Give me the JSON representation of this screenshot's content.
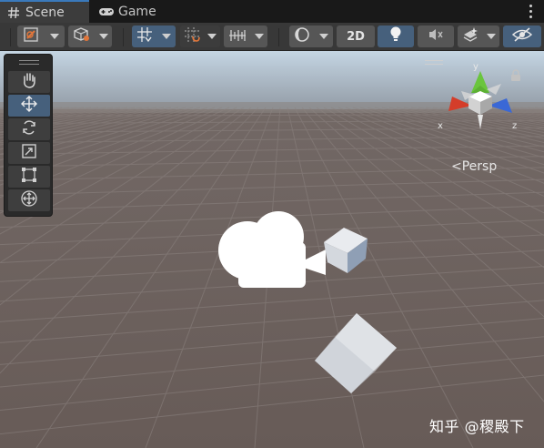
{
  "tabs": {
    "scene": {
      "label": "Scene",
      "icon": "hash-icon"
    },
    "game": {
      "label": "Game",
      "icon": "gamepad-icon"
    }
  },
  "toolbar": {
    "draw_mode_icon": "draw-mode-icon",
    "gizmo_icon": "cube-orientation-icon",
    "grid_icon": "grid-icon",
    "snap_icon": "snap-icon",
    "increment_icon": "increment-snap-icon",
    "shading_icon": "shading-icon",
    "mode_2d_label": "2D",
    "lighting_icon": "lightbulb-icon",
    "audio_icon": "audio-muted-icon",
    "effects_icon": "effects-icon",
    "visibility_icon": "hidden-eye-icon"
  },
  "tools": [
    "hand-tool",
    "move-tool",
    "rotate-tool",
    "scale-tool",
    "rect-tool",
    "transform-tool"
  ],
  "orientation_gizmo": {
    "x_label": "x",
    "y_label": "y",
    "z_label": "z",
    "projection_label": "<Persp",
    "colors": {
      "x": "#d43d2a",
      "y": "#6ac53d",
      "z": "#3a68d6"
    }
  },
  "watermark": "知乎 @稷殿下",
  "colors": {
    "accent": "#46607c",
    "active_tab_border": "#3a79bb",
    "sky": "#c5d6e4",
    "ground": "#6a5e5a"
  }
}
